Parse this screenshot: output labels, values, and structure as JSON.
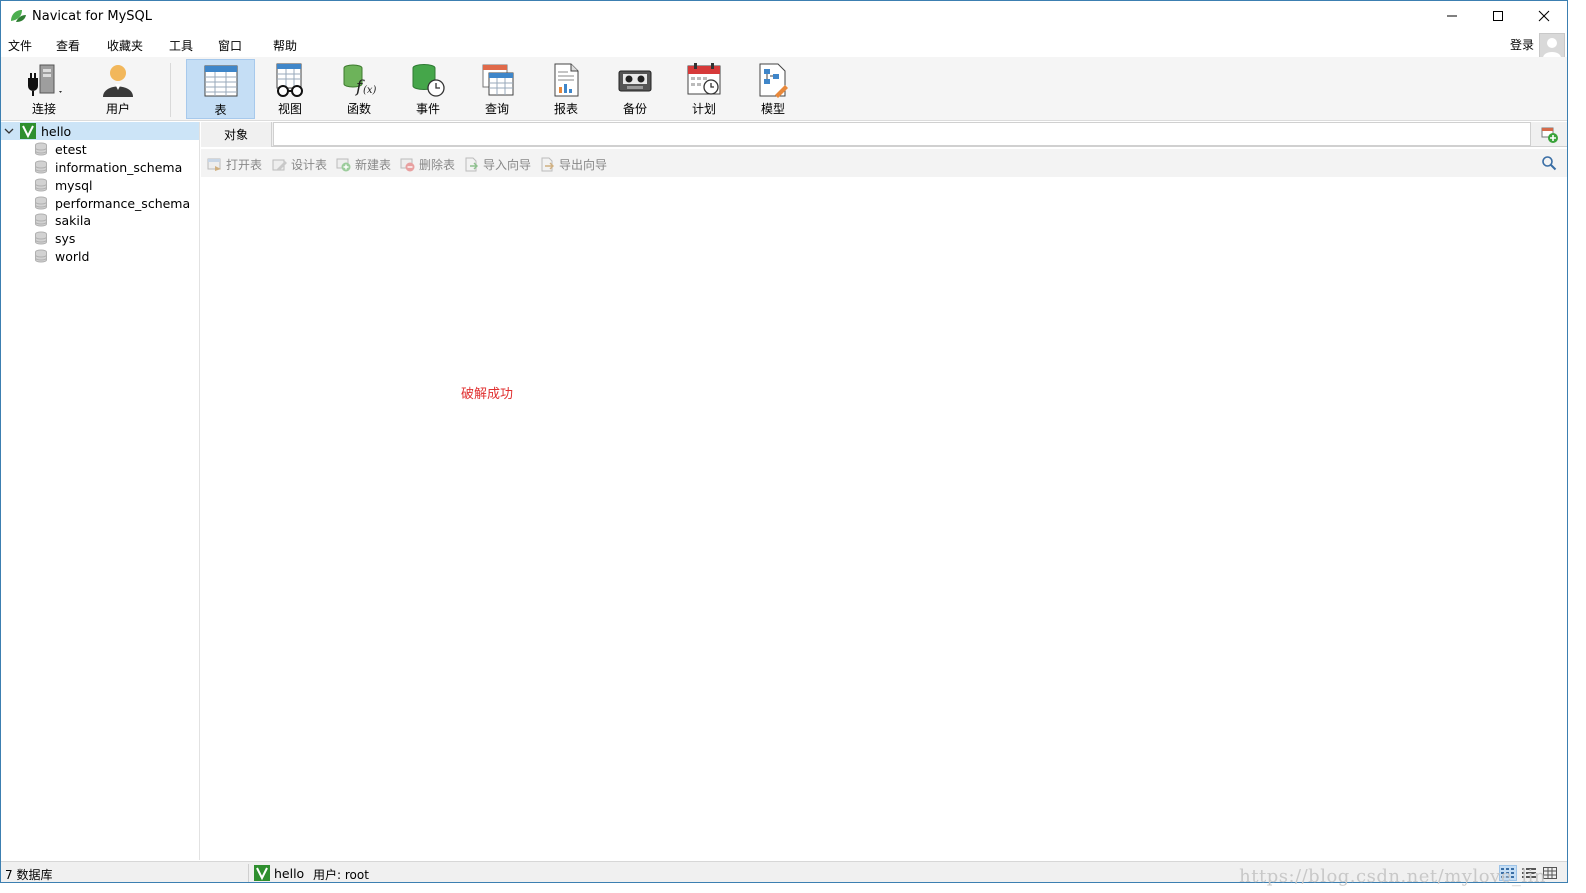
{
  "window": {
    "title": "Navicat for MySQL"
  },
  "menu": {
    "items": [
      "文件",
      "查看",
      "收藏夹",
      "工具",
      "窗口",
      "帮助"
    ],
    "login": "登录"
  },
  "toolbar": {
    "items": [
      {
        "label": "连接",
        "icon": "connection-plug-icon"
      },
      {
        "label": "用户",
        "icon": "user-icon"
      },
      {
        "label": "表",
        "icon": "table-icon",
        "active": true
      },
      {
        "label": "视图",
        "icon": "view-glasses-icon"
      },
      {
        "label": "函数",
        "icon": "function-icon"
      },
      {
        "label": "事件",
        "icon": "event-clock-icon"
      },
      {
        "label": "查询",
        "icon": "query-icon"
      },
      {
        "label": "报表",
        "icon": "report-icon"
      },
      {
        "label": "备份",
        "icon": "backup-tape-icon"
      },
      {
        "label": "计划",
        "icon": "schedule-calendar-icon"
      },
      {
        "label": "模型",
        "icon": "model-icon"
      }
    ]
  },
  "tree": {
    "connection": "hello",
    "databases": [
      "etest",
      "information_schema",
      "mysql",
      "performance_schema",
      "sakila",
      "sys",
      "world"
    ]
  },
  "objects": {
    "tab_label": "对象",
    "actions": [
      "打开表",
      "设计表",
      "新建表",
      "删除表",
      "导入向导",
      "导出向导"
    ]
  },
  "content": {
    "message": "破解成功"
  },
  "status": {
    "db_count": "7 数据库",
    "connection": "hello",
    "user": "用户: root"
  },
  "watermark": "https://blog.csdn.net/mylove_lin",
  "colors": {
    "accent": "#c5def5",
    "message": "#e03030",
    "tree_selected": "#cce4f7"
  }
}
